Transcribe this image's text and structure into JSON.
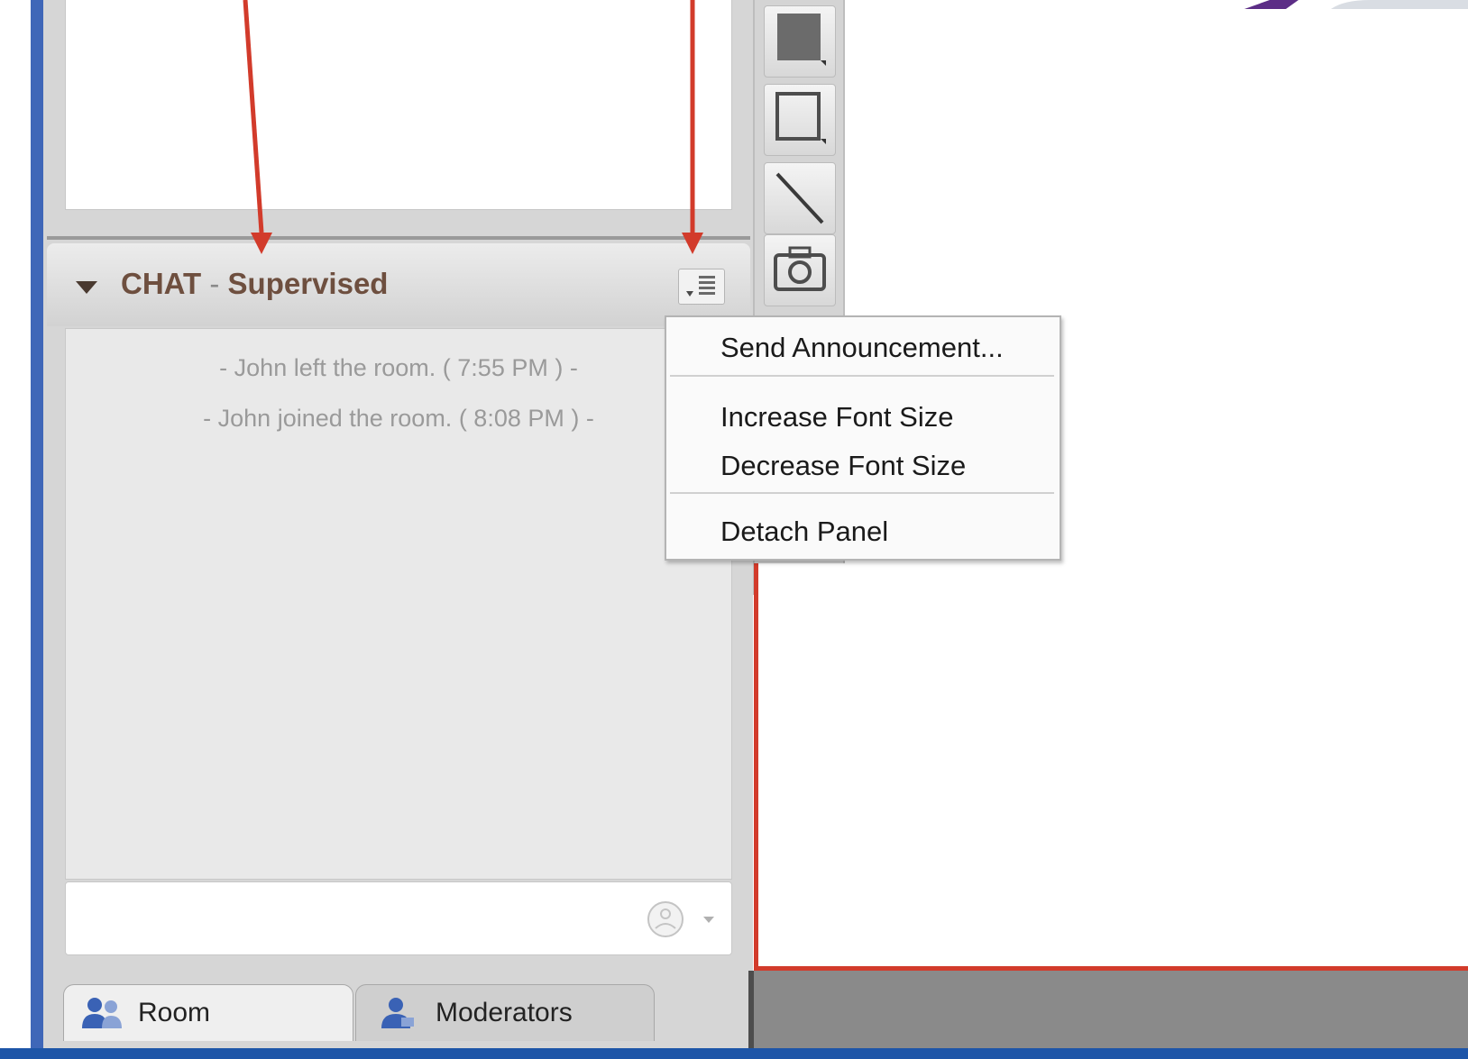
{
  "chat": {
    "title_prefix": "CHAT",
    "title_sep": "-",
    "title_mode": "Supervised",
    "messages": [
      "- John left the room. ( 7:55 PM ) -",
      "- John joined the room. ( 8:08 PM ) -"
    ],
    "input_value": ""
  },
  "menu": {
    "send_announcement": "Send Announcement...",
    "increase_font": "Increase Font Size",
    "decrease_font": "Decrease Font Size",
    "detach_panel": "Detach Panel"
  },
  "tabs": {
    "room": "Room",
    "moderators": "Moderators"
  },
  "toolbar": {
    "tools": [
      "filled-rectangle-icon",
      "rectangle-icon",
      "line-icon",
      "camera-icon"
    ]
  },
  "colors": {
    "annotation": "#d23b2b",
    "window_border": "#3f67b8",
    "title_text": "#6e4f3f"
  }
}
